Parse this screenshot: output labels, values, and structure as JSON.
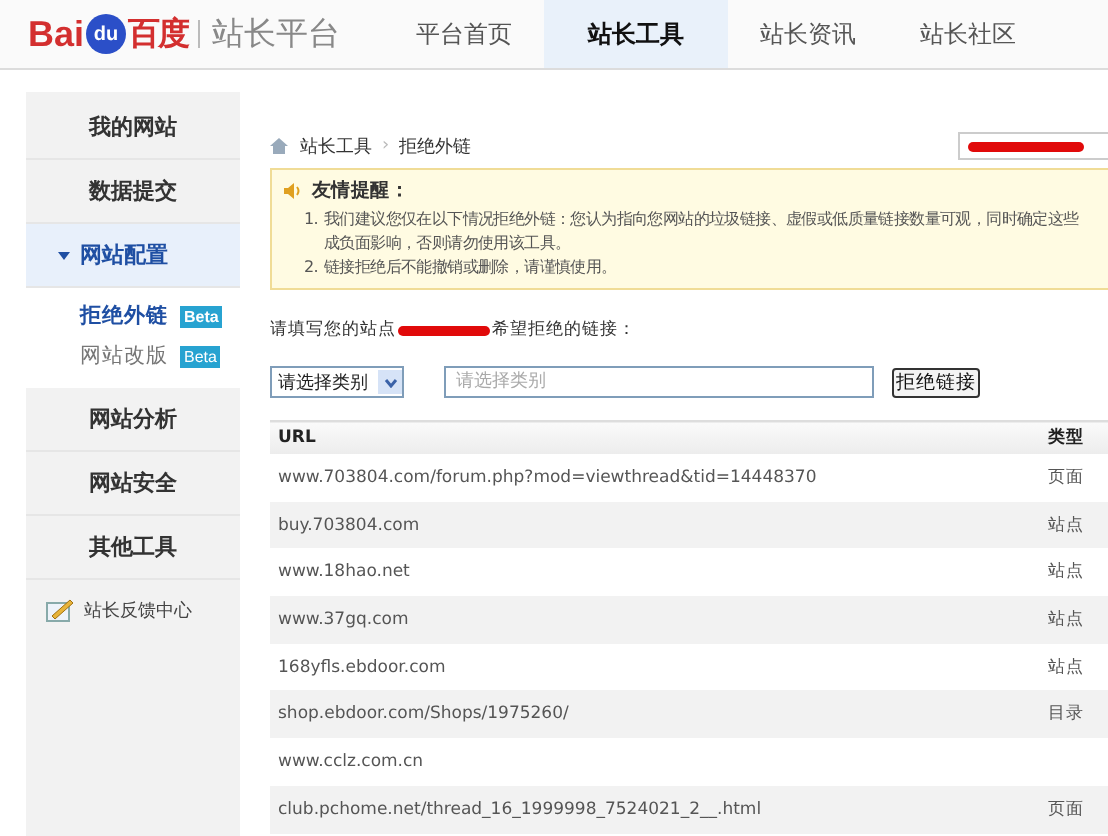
{
  "header": {
    "logo": {
      "brand": "Bai",
      "paw": "du",
      "chinese": "百度"
    },
    "product": "站长平台",
    "tabs": [
      {
        "label": "平台首页",
        "selected": false
      },
      {
        "label": "站长工具",
        "selected": true
      },
      {
        "label": "站长资讯",
        "selected": false
      },
      {
        "label": "站长社区",
        "selected": false
      }
    ]
  },
  "sidebar": {
    "items": [
      {
        "label": "我的网站",
        "expanded": false
      },
      {
        "label": "数据提交",
        "expanded": false
      },
      {
        "label": "网站配置",
        "expanded": true,
        "children": [
          {
            "label": "拒绝外链",
            "selected": true,
            "badge": "Beta"
          },
          {
            "label": "网站改版",
            "selected": false,
            "badge": "Beta"
          }
        ]
      },
      {
        "label": "网站分析",
        "expanded": false
      },
      {
        "label": "网站安全",
        "expanded": false
      },
      {
        "label": "其他工具",
        "expanded": false
      }
    ],
    "feedback": "站长反馈中心"
  },
  "breadcrumb": [
    "站长工具",
    "拒绝外链"
  ],
  "breadcrumb_separator": "›",
  "notice": {
    "title": "友情提醒：",
    "items": [
      {
        "number": "1.",
        "lines": [
          "我们建议您仅在以下情况拒绝外链：您认为指向您网站的垃圾链接、虚假或低质量链接数量可观，同时确定这些",
          "成负面影响，否则请勿使用该工具。"
        ]
      },
      {
        "number": "2.",
        "lines": [
          "链接拒绝后不能撤销或删除，请谨慎使用。"
        ]
      }
    ]
  },
  "prompt": {
    "before": "请填写您的站点",
    "after": "希望拒绝的链接："
  },
  "form": {
    "category": "请选择类别",
    "input_placeholder": "请选择类别",
    "submit": "拒绝链接"
  },
  "table": {
    "columns": [
      "URL",
      "类型"
    ],
    "rows": [
      {
        "url": "www.703804.com/forum.php?mod=viewthread&tid=14448370",
        "type": "页面"
      },
      {
        "url": "buy.703804.com",
        "type": "站点"
      },
      {
        "url": "www.18hao.net",
        "type": "站点"
      },
      {
        "url": "www.37gq.com",
        "type": "站点"
      },
      {
        "url": "168yfls.ebdoor.com",
        "type": "站点"
      },
      {
        "url": "shop.ebdoor.com/Shops/1975260/",
        "type": "目录"
      },
      {
        "url": "www.cclz.com.cn"
      },
      {
        "url": "club.pchome.net/thread_16_1999998_7524021_2__.html",
        "type": "页面"
      }
    ]
  }
}
